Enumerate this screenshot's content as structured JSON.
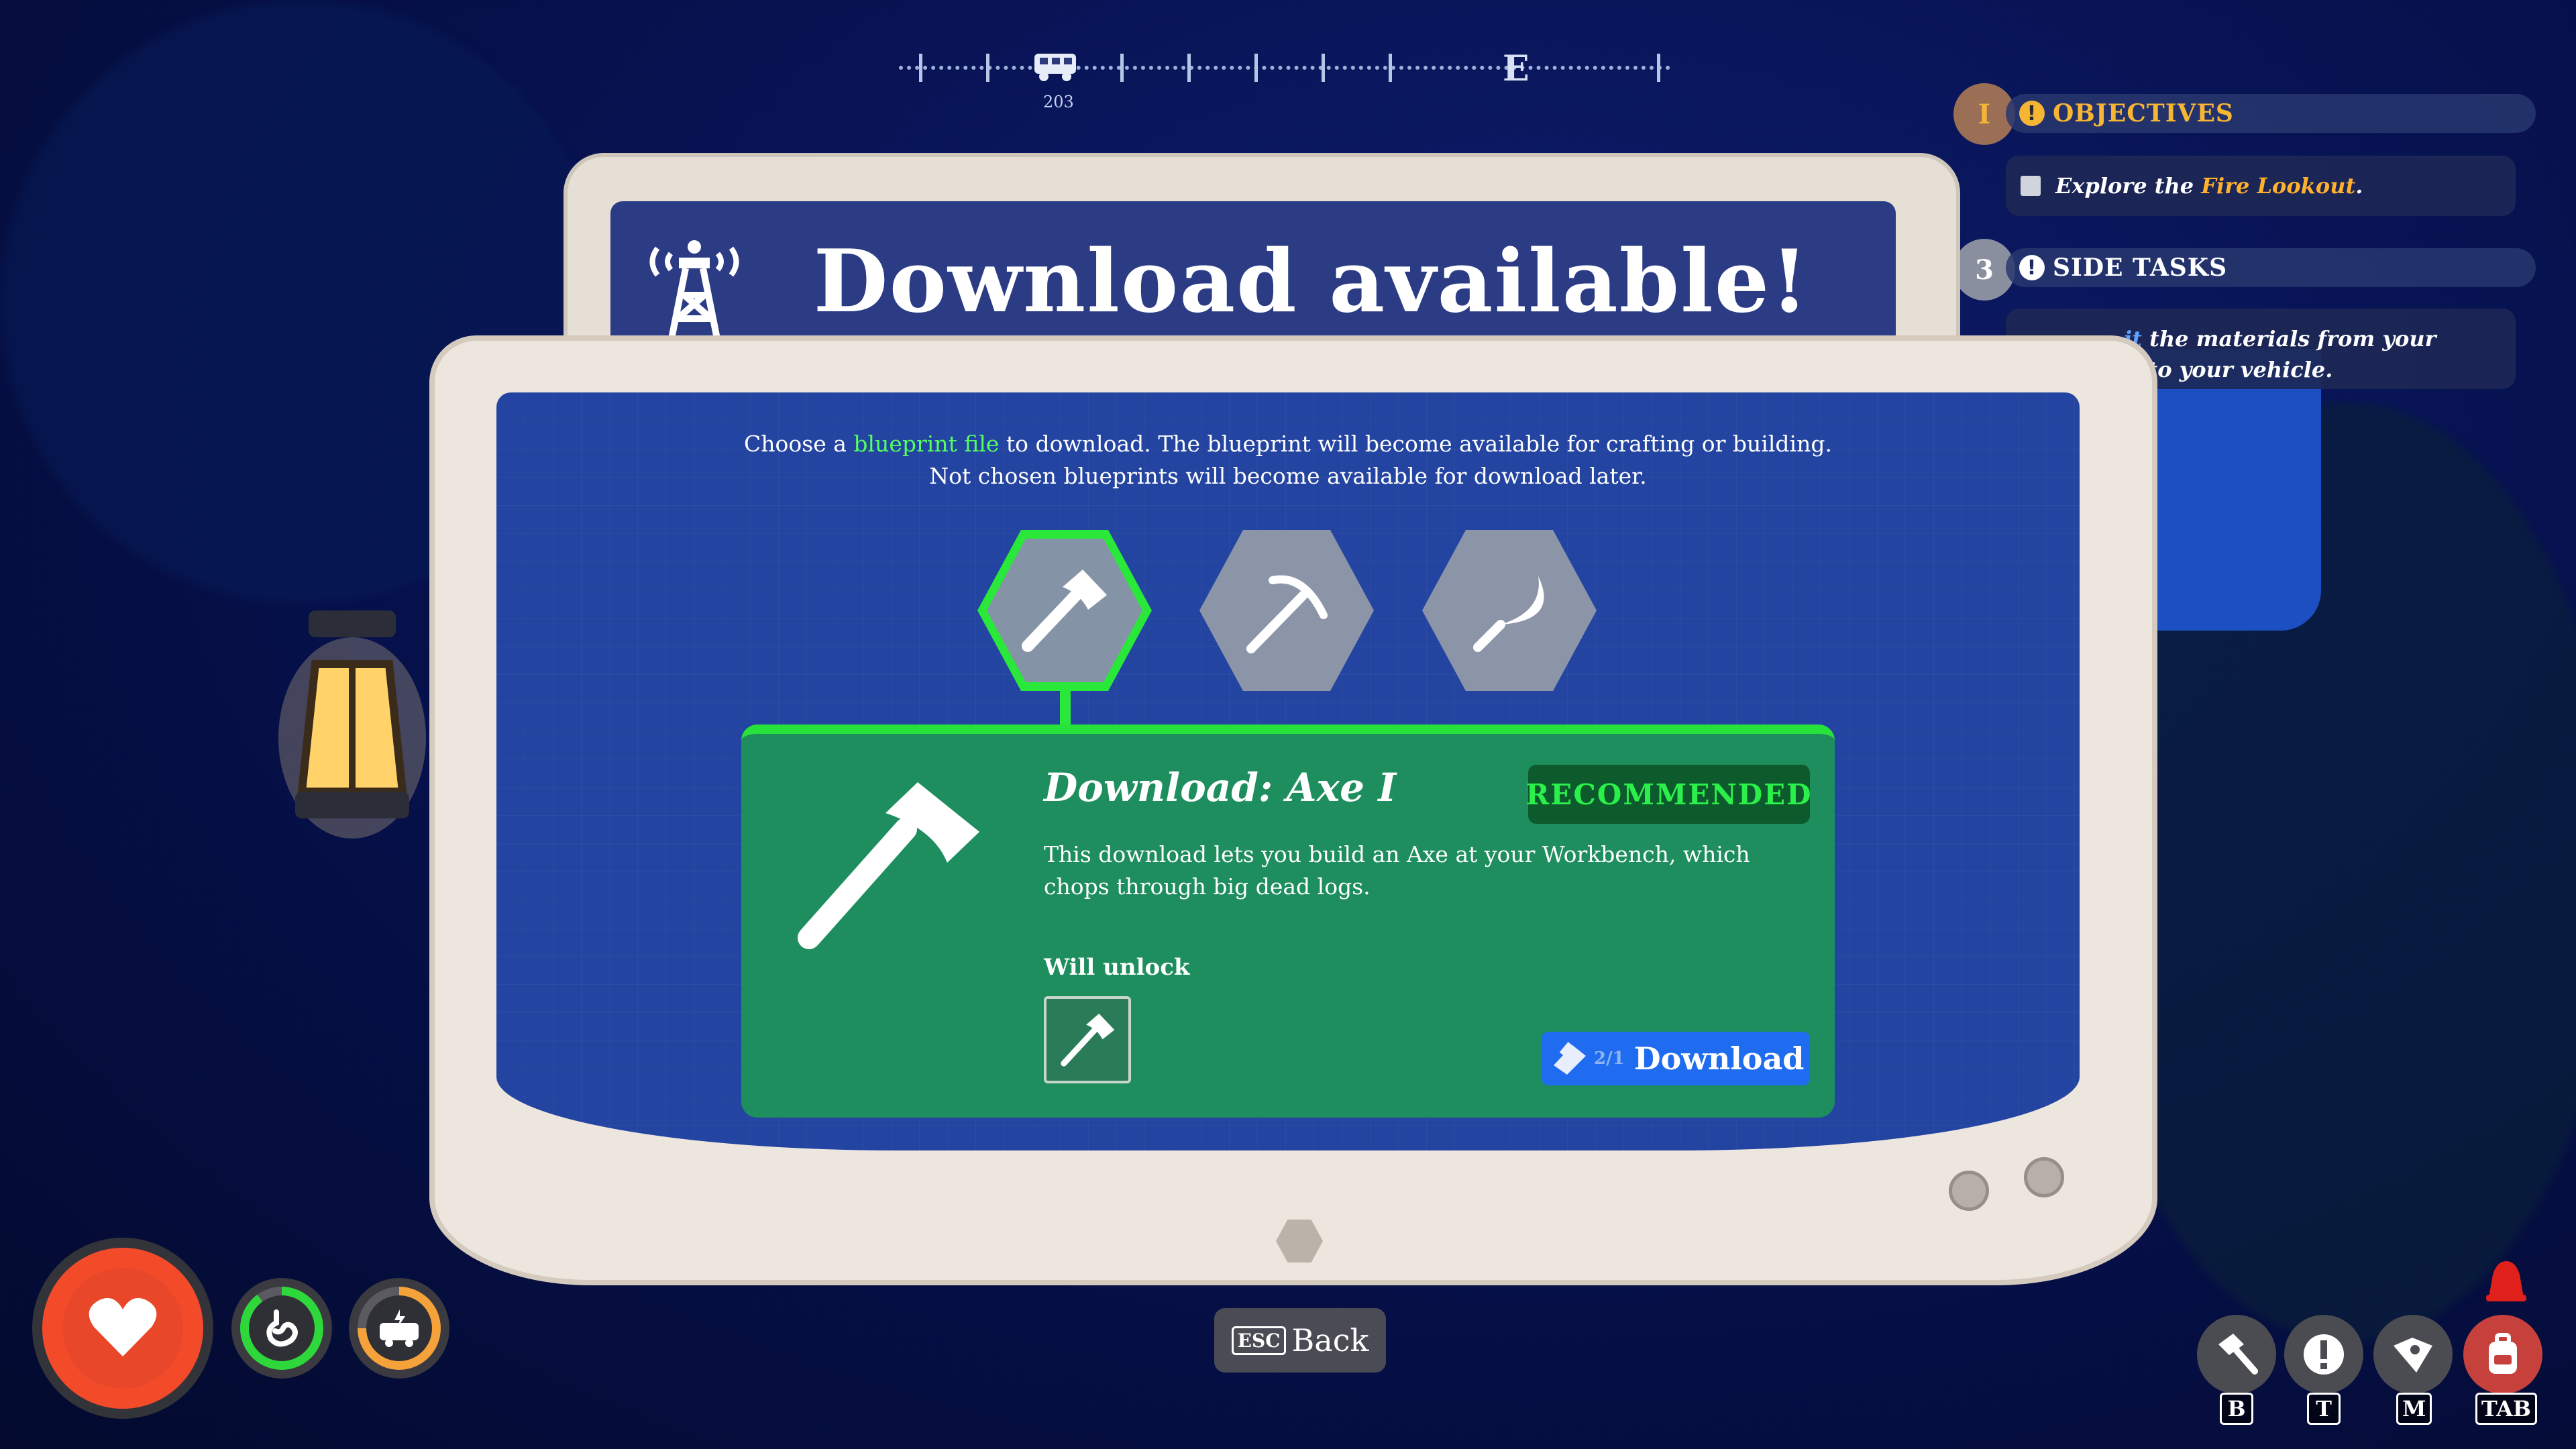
{
  "compass": {
    "letter_e": "E",
    "vehicle_distance": "203"
  },
  "objectives": {
    "circle_label": "I",
    "header": "OBJECTIVES",
    "task_prefix": "Explore the ",
    "task_highlight": "Fire Lookout",
    "task_suffix": "."
  },
  "side_tasks": {
    "circle_label": "3",
    "header": "SIDE TASKS",
    "line1_partial": "it",
    "line1_rest": " the materials from your",
    "line2": "into your vehicle."
  },
  "dialog": {
    "title": "Download available!",
    "intro_before": "Choose a ",
    "intro_link": "blueprint file",
    "intro_after": " to download. The blueprint will become available for crafting or building. Not chosen blueprints will become available for download later.",
    "options": [
      {
        "icon": "axe-icon",
        "selected": true
      },
      {
        "icon": "pickaxe-icon",
        "selected": false
      },
      {
        "icon": "sickle-icon",
        "selected": false
      }
    ],
    "card": {
      "title": "Download: Axe I",
      "badge": "RECOMMENDED",
      "description": "This download lets you build an Axe at your Workbench, which chops through big dead logs.",
      "unlock_label": "Will unlock",
      "download_count": "2/1",
      "download_label": "Download"
    }
  },
  "back": {
    "key": "ESC",
    "label": "Back"
  },
  "hotkeys": [
    {
      "icon": "hammer-icon",
      "key": "B"
    },
    {
      "icon": "exclamation-icon",
      "key": "T"
    },
    {
      "icon": "map-icon",
      "key": "M"
    },
    {
      "icon": "backpack-icon",
      "key": "TAB"
    }
  ],
  "colors": {
    "accent_green": "#29e83a",
    "card_green": "#1f8e5e",
    "screen_blue": "#2344a0",
    "button_blue": "#1f6cf0",
    "objective_orange": "#f7b534",
    "health_red": "#f34a2a"
  },
  "status": {
    "health": 1.0,
    "hunger": 0.9,
    "vehicle_fuel": 0.75
  }
}
